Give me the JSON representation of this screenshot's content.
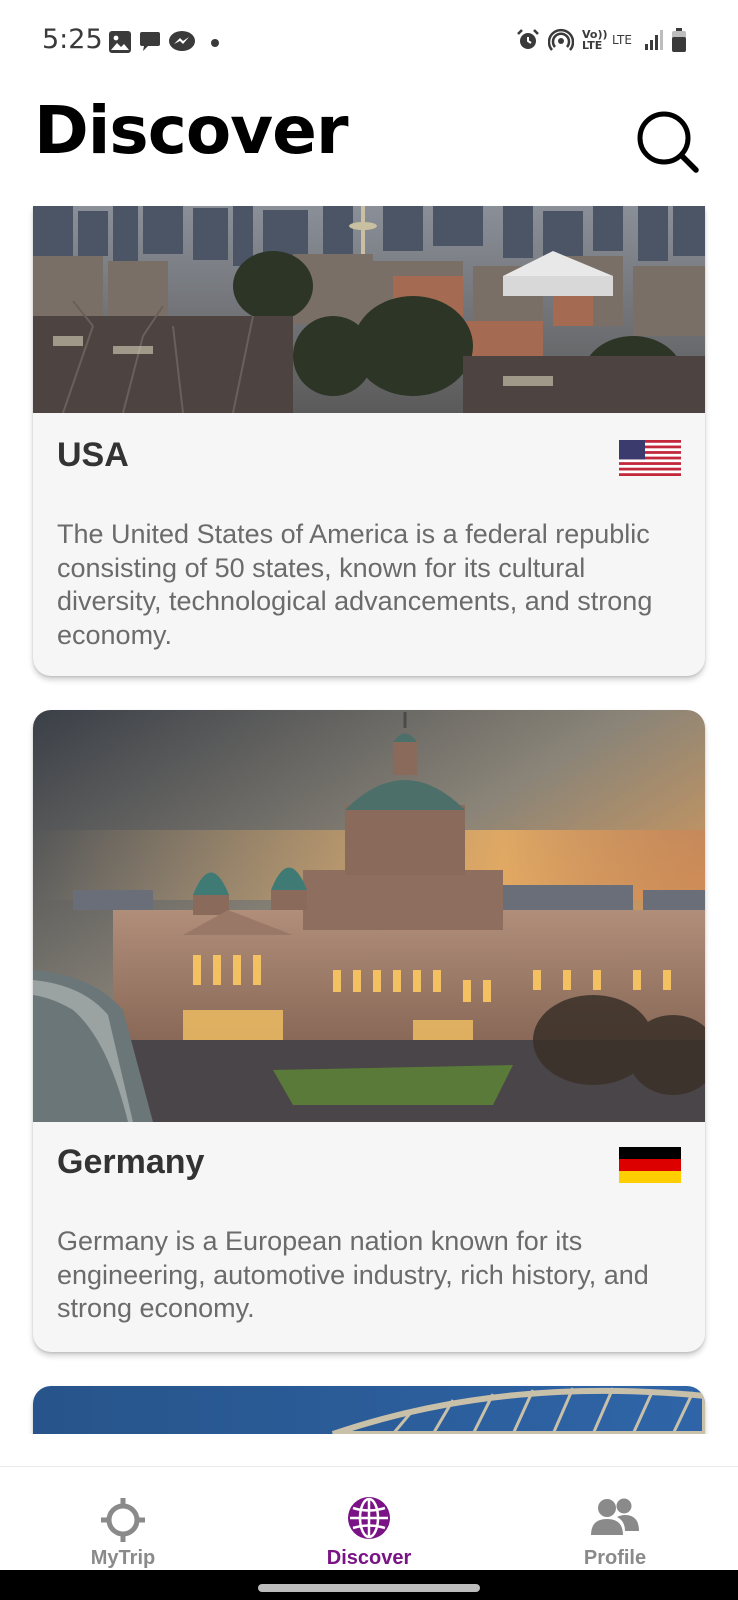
{
  "status_bar": {
    "time": "5:25",
    "left_icons": [
      "gallery-icon",
      "chat-bubble-icon",
      "messenger-icon",
      "dot-icon"
    ],
    "right_icons": [
      "alarm-icon",
      "hotspot-icon",
      "volte-icon",
      "lte-icon",
      "signal-icon",
      "battery-icon"
    ],
    "volte_label": "Vo)) LTE",
    "lte_label": "LTE"
  },
  "header": {
    "title": "Discover",
    "search_icon": "search-icon"
  },
  "cards": [
    {
      "title": "USA",
      "flag": "us-flag-icon",
      "description": "The United States of America is a federal republic consisting of 50 states, known for its cultural diversity, technological advancements, and strong economy."
    },
    {
      "title": "Germany",
      "flag": "germany-flag-icon",
      "description": "Germany is a European nation known for its engineering, automotive industry, rich history, and strong economy."
    }
  ],
  "bottom_nav": {
    "items": [
      {
        "label": "MyTrip",
        "icon": "crosshair-icon",
        "active": false
      },
      {
        "label": "Discover",
        "icon": "globe-icon",
        "active": true
      },
      {
        "label": "Profile",
        "icon": "people-icon",
        "active": false
      }
    ]
  },
  "colors": {
    "accent": "#7a1385",
    "inactive": "#8a8a8a",
    "card_bg": "#f6f6f6",
    "title": "#000000",
    "desc": "#6b6b6b"
  }
}
